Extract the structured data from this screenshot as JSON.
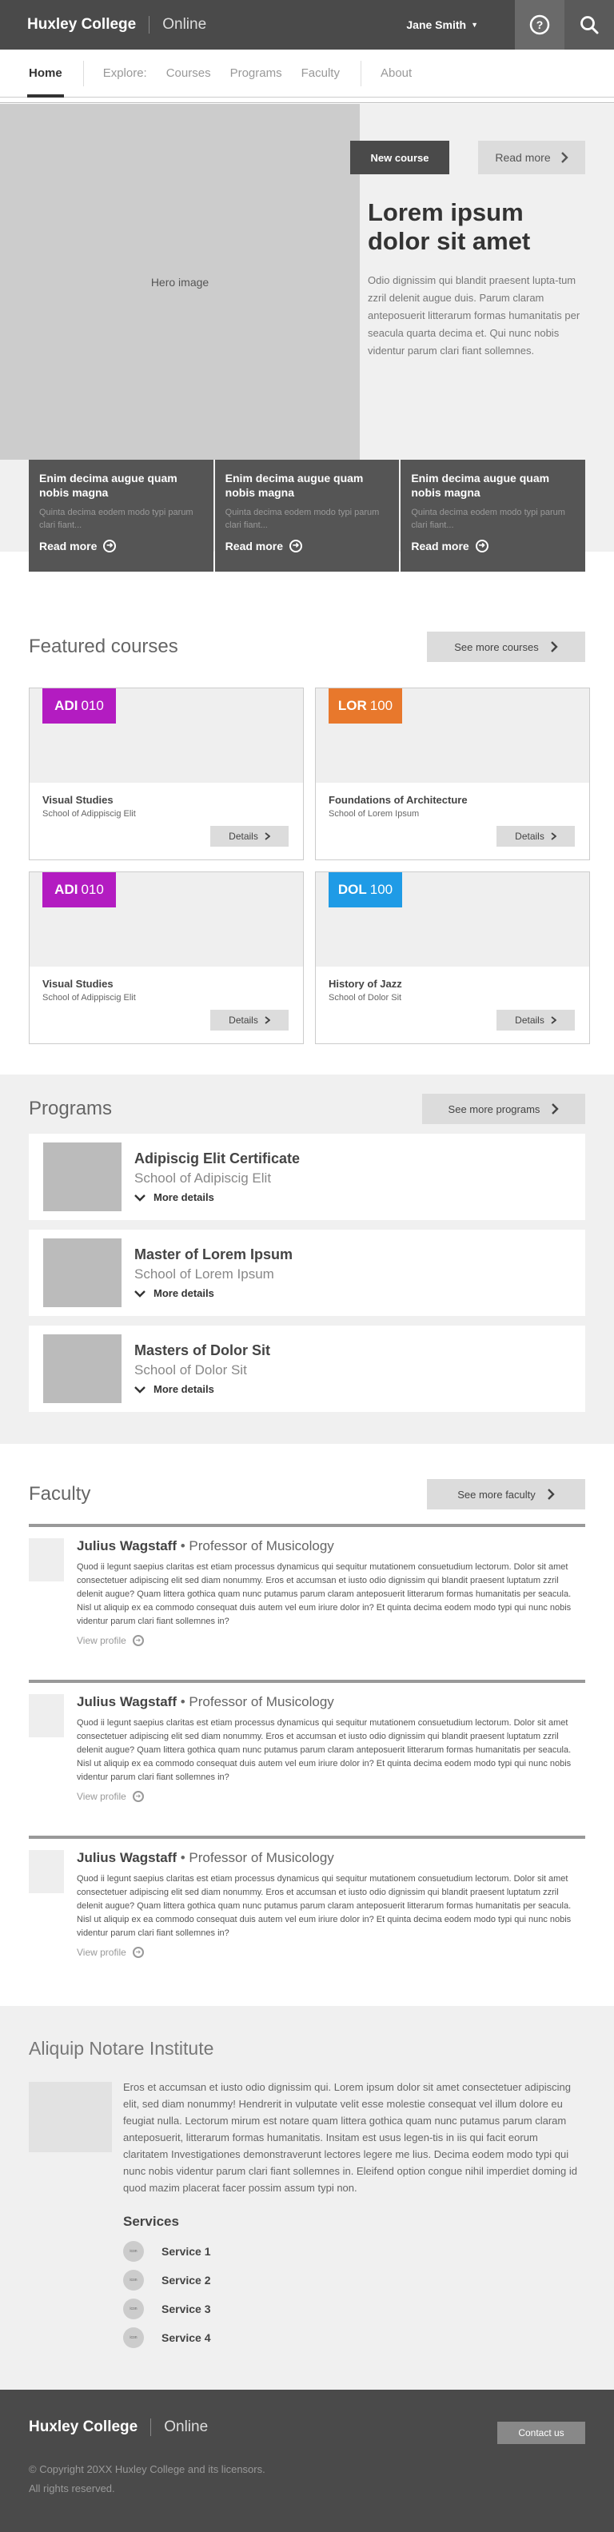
{
  "header": {
    "brand": "Huxley College",
    "brand_sub": "Online",
    "user": "Jane Smith",
    "help_icon": "question-circle-icon",
    "search_icon": "search-icon"
  },
  "nav": {
    "home": "Home",
    "explore_label": "Explore:",
    "items": [
      "Courses",
      "Programs",
      "Faculty"
    ],
    "about": "About"
  },
  "hero": {
    "image_label": "Hero image",
    "badge": "New course",
    "read_more": "Read more",
    "title": "Lorem ipsum dolor sit amet",
    "text": "Odio dignissim qui blandit praesent lupta-tum zzril delenit augue duis. Parum claram anteposuerit litterarum formas humanitatis per seacula quarta decima et. Qui nunc nobis videntur parum clari fiant sollemnes.",
    "cards": [
      {
        "title": "Enim decima augue quam nobis magna",
        "text": "Quinta decima eodem modo typi parum clari fiant...",
        "link": "Read more"
      },
      {
        "title": "Enim decima augue quam nobis magna",
        "text": "Quinta decima eodem modo typi parum clari fiant...",
        "link": "Read more"
      },
      {
        "title": "Enim decima augue quam nobis magna",
        "text": "Quinta decima eodem modo typi parum clari fiant...",
        "link": "Read more"
      }
    ]
  },
  "featured": {
    "title": "Featured courses",
    "see_more": "See more courses",
    "courses": [
      {
        "code": "ADI",
        "number": "010",
        "color": "#b31cc1",
        "name": "Visual Studies",
        "school": "School of Adippiscig Elit",
        "details": "Details"
      },
      {
        "code": "LOR",
        "number": "100",
        "color": "#e8782c",
        "name": "Foundations of Architecture",
        "school": "School of Lorem Ipsum",
        "details": "Details"
      },
      {
        "code": "ADI",
        "number": "010",
        "color": "#b31cc1",
        "name": "Visual Studies",
        "school": "School of Adippiscig Elit",
        "details": "Details"
      },
      {
        "code": "DOL",
        "number": "100",
        "color": "#1f9be6",
        "name": "History of Jazz",
        "school": "School of Dolor Sit",
        "details": "Details"
      }
    ]
  },
  "programs": {
    "title": "Programs",
    "see_more": "See more programs",
    "items": [
      {
        "name": "Adipiscig Elit Certificate",
        "school": "School of Adipiscig Elit",
        "more": "More details"
      },
      {
        "name": "Master of Lorem Ipsum",
        "school": "School of Lorem Ipsum",
        "more": "More details"
      },
      {
        "name": "Masters of Dolor Sit",
        "school": "School of Dolor Sit",
        "more": "More details"
      }
    ]
  },
  "faculty": {
    "title": "Faculty",
    "see_more": "See more faculty",
    "members": [
      {
        "name": "Julius Wagstaff",
        "role": "Professor of Musicology",
        "bio": "Quod ii legunt saepius claritas est etiam processus dynamicus qui sequitur mutationem consuetudium lectorum. Dolor sit amet consectetuer adipiscing elit sed diam nonummy. Eros et accumsan et iusto odio dignissim qui blandit praesent luptatum zzril delenit augue? Quam littera gothica quam nunc putamus parum claram anteposuerit litterarum formas humanitatis per seacula. Nisl ut aliquip ex ea commodo consequat duis autem vel eum iriure dolor in? Et quinta decima eodem modo typi qui nunc nobis videntur parum clari fiant sollemnes in?",
        "profile": "View profile"
      },
      {
        "name": "Julius Wagstaff",
        "role": "Professor of Musicology",
        "bio": "Quod ii legunt saepius claritas est etiam processus dynamicus qui sequitur mutationem consuetudium lectorum. Dolor sit amet consectetuer adipiscing elit sed diam nonummy. Eros et accumsan et iusto odio dignissim qui blandit praesent luptatum zzril delenit augue? Quam littera gothica quam nunc putamus parum claram anteposuerit litterarum formas humanitatis per seacula. Nisl ut aliquip ex ea commodo consequat duis autem vel eum iriure dolor in? Et quinta decima eodem modo typi qui nunc nobis videntur parum clari fiant sollemnes in?",
        "profile": "View profile"
      },
      {
        "name": "Julius Wagstaff",
        "role": "Professor of Musicology",
        "bio": "Quod ii legunt saepius claritas est etiam processus dynamicus qui sequitur mutationem consuetudium lectorum. Dolor sit amet consectetuer adipiscing elit sed diam nonummy. Eros et accumsan et iusto odio dignissim qui blandit praesent luptatum zzril delenit augue? Quam littera gothica quam nunc putamus parum claram anteposuerit litterarum formas humanitatis per seacula. Nisl ut aliquip ex ea commodo consequat duis autem vel eum iriure dolor in? Et quinta decima eodem modo typi qui nunc nobis videntur parum clari fiant sollemnes in?",
        "profile": "View profile"
      }
    ]
  },
  "institute": {
    "title": "Aliquip Notare Institute",
    "text": "Eros et accumsan et iusto odio dignissim qui. Lorem ipsum dolor sit amet consectetuer adipiscing elit, sed diam nonummy! Hendrerit in vulputate velit esse molestie consequat vel illum dolore eu feugiat nulla. Lectorum mirum est notare quam littera gothica quam nunc putamus parum claram anteposuerit, litterarum formas humanitatis. Insitam est usus legen-tis in iis qui facit eorum claritatem Investigationes demonstraverunt lectores legere me lius. Decima eodem modo typi qui nunc nobis videntur parum clari fiant sollemnes in. Eleifend option congue nihil imperdiet doming id quod mazim placerat facer possim assum typi non.",
    "services_title": "Services",
    "icon_label": "icon",
    "services": [
      "Service 1",
      "Service 2",
      "Service 3",
      "Service 4"
    ]
  },
  "footer": {
    "brand": "Huxley College",
    "brand_sub": "Online",
    "contact": "Contact us",
    "copyright_1": "© Copyright 20XX Huxley College and its licensors.",
    "copyright_2": "All rights reserved."
  }
}
